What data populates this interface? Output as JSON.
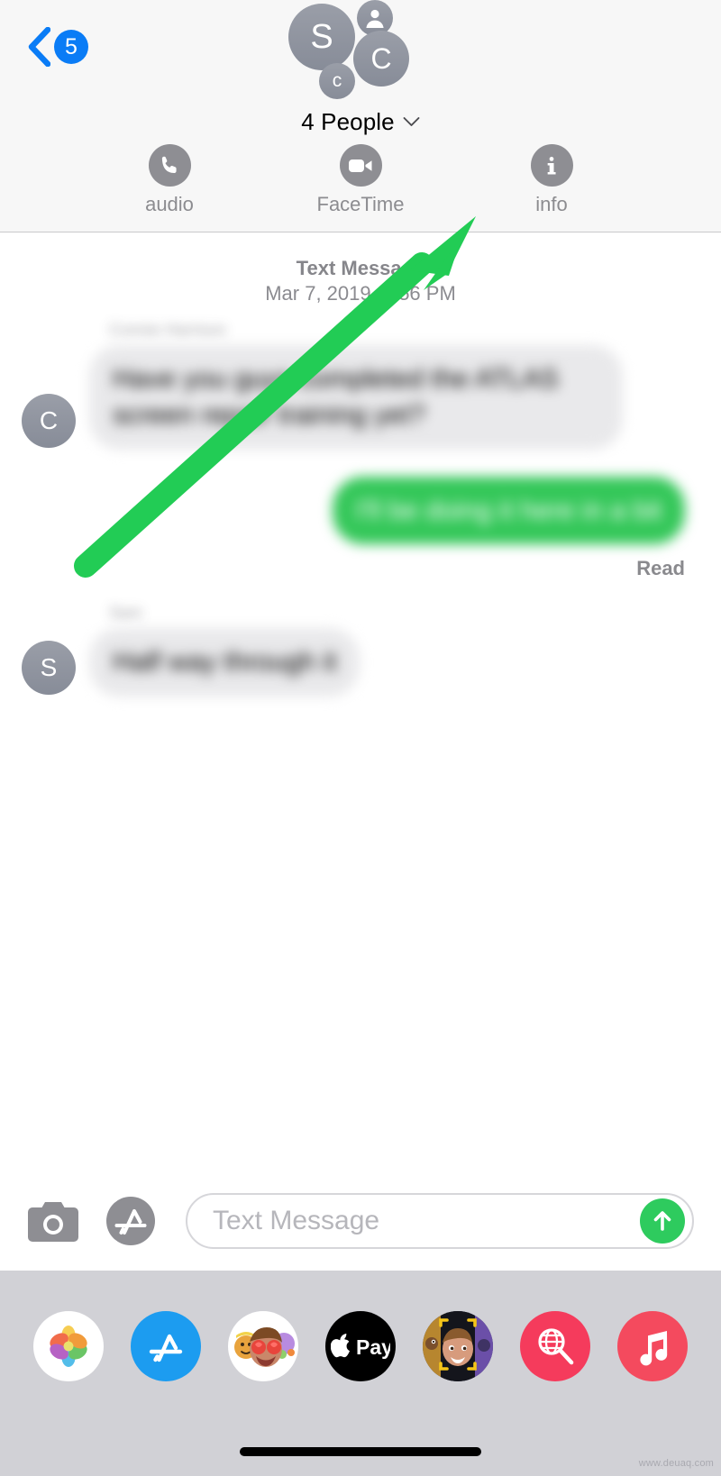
{
  "header": {
    "back": {
      "icon": "chevron-left-icon",
      "badge_count": "5"
    },
    "avatars": [
      {
        "id": "s",
        "label": "S",
        "kind": "initial"
      },
      {
        "id": "person",
        "label": "",
        "kind": "person-silhouette"
      },
      {
        "id": "c",
        "label": "C",
        "kind": "initial"
      },
      {
        "id": "c2",
        "label": "c",
        "kind": "initial"
      }
    ],
    "group_title": "4 People",
    "disclosure_icon": "chevron-down-icon",
    "actions": [
      {
        "icon": "phone-icon",
        "label": "audio"
      },
      {
        "icon": "video-camera-icon",
        "label": "FaceTime"
      },
      {
        "icon": "info-icon",
        "label": "info"
      }
    ]
  },
  "thread": {
    "date_divider": {
      "kind": "Text Message",
      "when": "Mar 7, 2019, 4:56 PM"
    },
    "messages": [
      {
        "direction": "incoming",
        "avatar_initial": "C",
        "sender": "Connie Harrison",
        "text": "Have you guys completed the ATLAS screen repair training yet?",
        "redacted": true
      },
      {
        "direction": "outgoing",
        "avatar_initial": "",
        "sender": "",
        "text": "I'll be doing it here in a bit",
        "redacted": true
      },
      {
        "direction": "incoming",
        "avatar_initial": "S",
        "sender": "Sam",
        "text": "Half way through it",
        "redacted": true
      }
    ],
    "read_receipt": "Read"
  },
  "annotation": {
    "type": "arrow",
    "color": "#22cc55",
    "points_to": "info"
  },
  "composer": {
    "camera_icon": "camera-icon",
    "appstore_icon": "app-store-icon",
    "input_value": "",
    "input_placeholder": "Text Message",
    "send_icon": "arrow-up-icon"
  },
  "app_drawer": {
    "apps": [
      {
        "name": "photos-app-icon",
        "label": "Photos"
      },
      {
        "name": "app-store-app-icon",
        "label": "App Store"
      },
      {
        "name": "memoji-stickers-app-icon",
        "label": "Memoji Stickers"
      },
      {
        "name": "apple-pay-app-icon",
        "label": "Apple Pay"
      },
      {
        "name": "memoji-app-icon",
        "label": "Memoji"
      },
      {
        "name": "images-search-app-icon",
        "label": "#images"
      },
      {
        "name": "music-app-icon",
        "label": "Music"
      }
    ]
  },
  "footer": {
    "home_indicator": "home-indicator",
    "watermark": "www.deuaq.com"
  },
  "colors": {
    "accent_blue": "#0a7cf6",
    "bubble_green": "#34c759",
    "bubble_grey": "#e9e9eb",
    "annotation_green": "#22cc55",
    "nav_bg": "#f7f7f7",
    "drawer_bg": "#d1d1d6"
  }
}
